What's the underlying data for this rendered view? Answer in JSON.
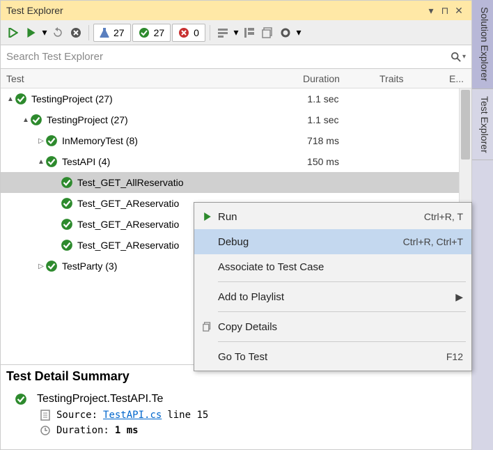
{
  "title_bar": {
    "title": "Test Explorer"
  },
  "side_tabs": [
    {
      "label": "Solution Explorer",
      "active": true
    },
    {
      "label": "Test Explorer",
      "active": false
    }
  ],
  "toolbar": {
    "counters": {
      "flask": "27",
      "pass": "27",
      "fail": "0"
    }
  },
  "search": {
    "placeholder": "Search Test Explorer"
  },
  "columns": {
    "test": "Test",
    "duration": "Duration",
    "traits": "Traits",
    "e": "E..."
  },
  "tree": [
    {
      "indent": 0,
      "twisty": "▲",
      "label": "TestingProject (27)",
      "duration": "1.1 sec",
      "selected": false
    },
    {
      "indent": 1,
      "twisty": "▲",
      "label": "TestingProject (27)",
      "duration": "1.1 sec",
      "selected": false
    },
    {
      "indent": 2,
      "twisty": "▷",
      "label": "InMemoryTest (8)",
      "duration": "718 ms",
      "selected": false
    },
    {
      "indent": 2,
      "twisty": "▲",
      "label": "TestAPI (4)",
      "duration": "150 ms",
      "selected": false
    },
    {
      "indent": 3,
      "twisty": "",
      "label": "Test_GET_AllReservatio",
      "duration": "",
      "selected": true
    },
    {
      "indent": 3,
      "twisty": "",
      "label": "Test_GET_AReservatio",
      "duration": "",
      "selected": false
    },
    {
      "indent": 3,
      "twisty": "",
      "label": "Test_GET_AReservatio",
      "duration": "",
      "selected": false
    },
    {
      "indent": 3,
      "twisty": "",
      "label": "Test_GET_AReservatio",
      "duration": "",
      "selected": false
    },
    {
      "indent": 2,
      "twisty": "▷",
      "label": "TestParty (3)",
      "duration": "",
      "selected": false
    }
  ],
  "detail": {
    "header": "Test Detail Summary",
    "fqname": "TestingProject.TestAPI.Te",
    "source_label": "Source:",
    "source_link": "TestAPI.cs",
    "source_line": "line 15",
    "duration_label": "Duration:",
    "duration_value": "1 ms"
  },
  "context_menu": [
    {
      "type": "item",
      "icon": "run",
      "label": "Run",
      "shortcut": "Ctrl+R, T",
      "hover": false
    },
    {
      "type": "item",
      "icon": "",
      "label": "Debug",
      "shortcut": "Ctrl+R, Ctrl+T",
      "hover": true
    },
    {
      "type": "item",
      "icon": "",
      "label": "Associate to Test Case",
      "shortcut": "",
      "hover": false
    },
    {
      "type": "sep"
    },
    {
      "type": "item",
      "icon": "",
      "label": "Add to Playlist",
      "shortcut": "▶",
      "hover": false
    },
    {
      "type": "sep"
    },
    {
      "type": "item",
      "icon": "copy",
      "label": "Copy Details",
      "shortcut": "",
      "hover": false
    },
    {
      "type": "sep"
    },
    {
      "type": "item",
      "icon": "",
      "label": "Go To Test",
      "shortcut": "F12",
      "hover": false
    }
  ]
}
